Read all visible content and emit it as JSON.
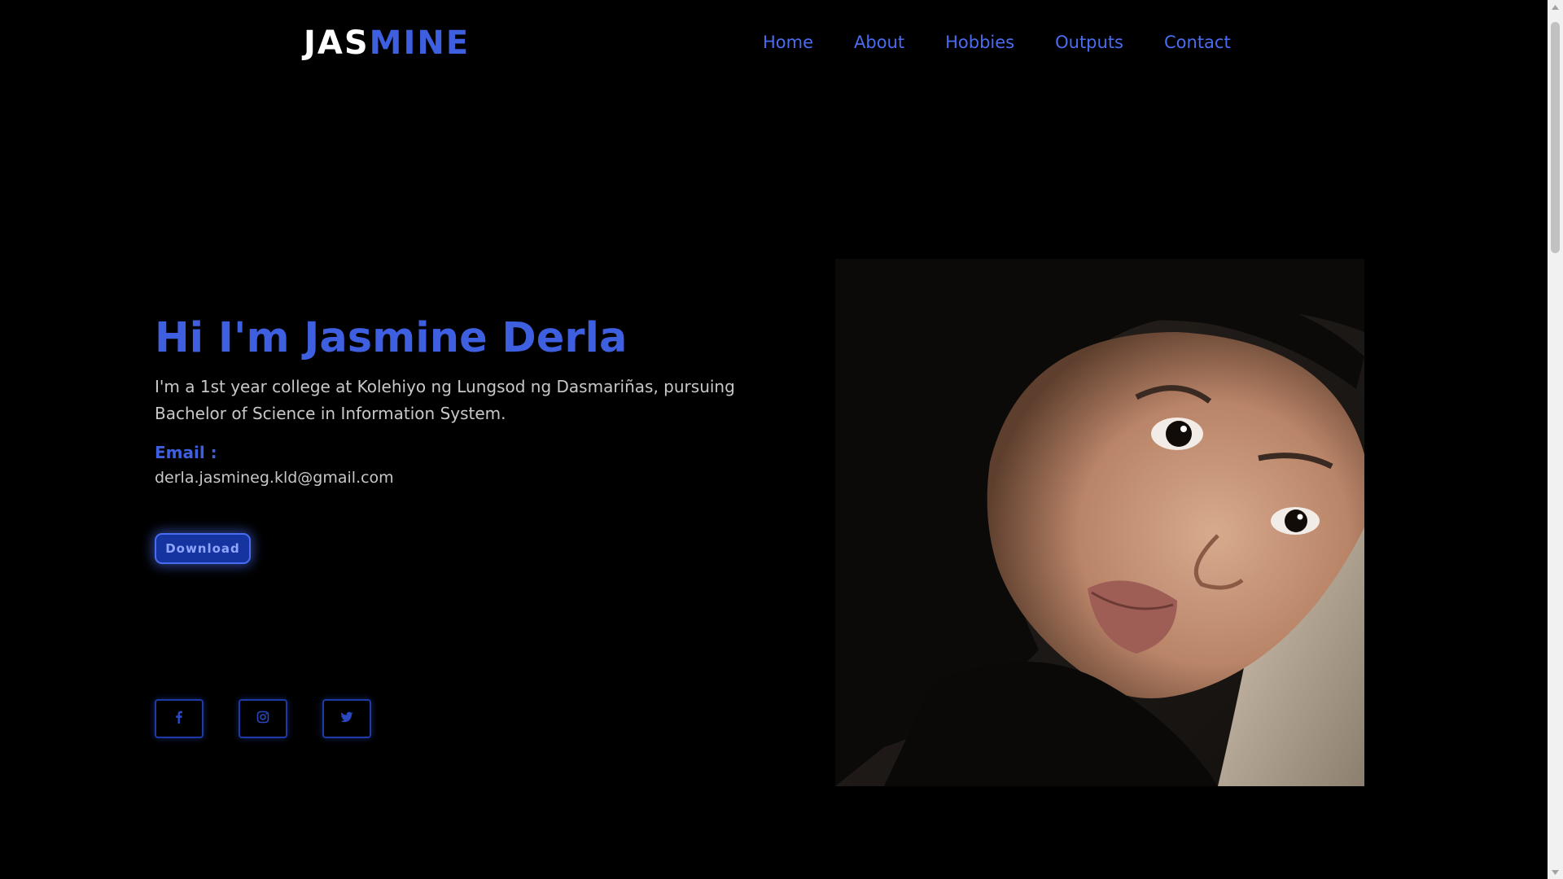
{
  "header": {
    "logo_part1": "JAS",
    "logo_part2": "MINE",
    "nav": [
      "Home",
      "About",
      "Hobbies",
      "Outputs",
      "Contact"
    ]
  },
  "hero": {
    "title": "Hi I'm Jasmine Derla",
    "description": "I'm a 1st year college at Kolehiyo ng Lungsod ng Dasmariñas, pursuing Bachelor of Science in Information System.",
    "email_label": "Email :",
    "email_value": "derla.jasmineg.kld@gmail.com",
    "download_label": "Download"
  },
  "socials": [
    {
      "icon": "facebook-icon"
    },
    {
      "icon": "instagram-icon"
    },
    {
      "icon": "twitter-icon"
    }
  ],
  "colors": {
    "background": "#000000",
    "accent": "#3d5fe0",
    "nav_text": "#4a6cf0",
    "body_text": "#c8c8c8"
  }
}
